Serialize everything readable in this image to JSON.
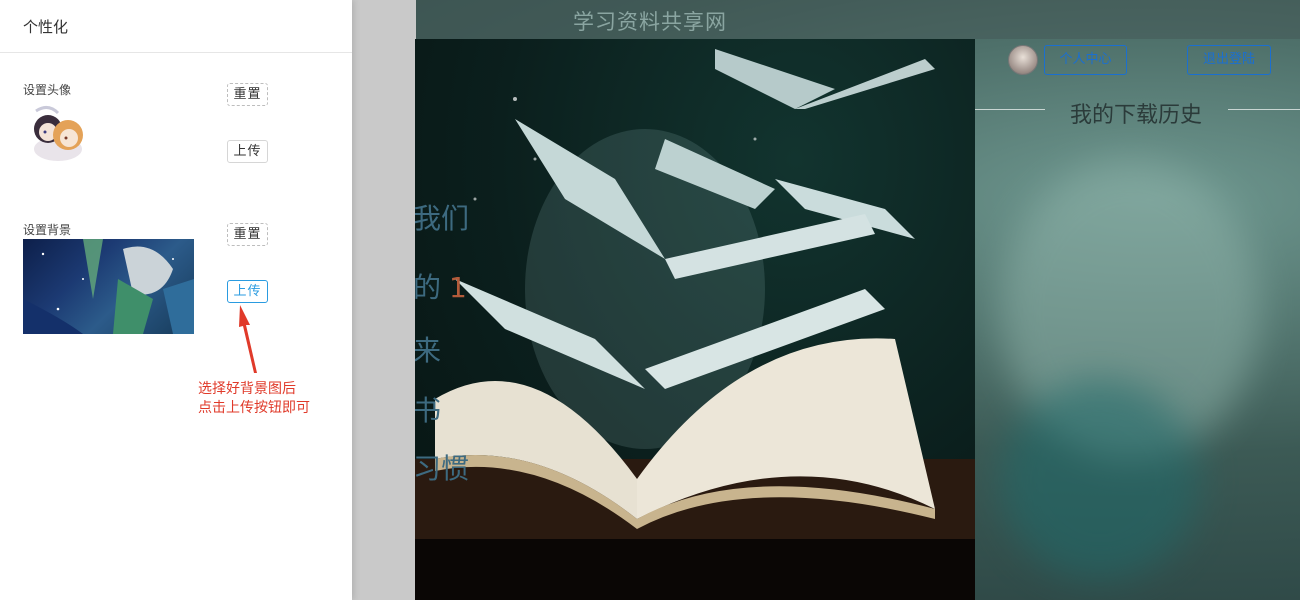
{
  "site": {
    "title": "学习资料共享网",
    "nav": {
      "personal_center": "个人中心",
      "logout": "退出登陆"
    },
    "download_history": "我的下载历史",
    "hero_lines": [
      "我们",
      "的",
      "来",
      "书",
      "习惯"
    ],
    "hero_number": "1"
  },
  "panel": {
    "title": "个性化",
    "avatar": {
      "label": "设置头像",
      "reset": "重置",
      "upload": "上传"
    },
    "background": {
      "label": "设置背景",
      "reset": "重置",
      "upload": "上传"
    }
  },
  "annotation": {
    "line1": "选择好背景图后",
    "line2": "点击上传按钮即可"
  },
  "colors": {
    "accent": "#2a9be0",
    "annotation": "#e03a2a",
    "nav_button": "#1b6fd0"
  },
  "icons": {
    "arrow": "up-arrow-icon"
  }
}
